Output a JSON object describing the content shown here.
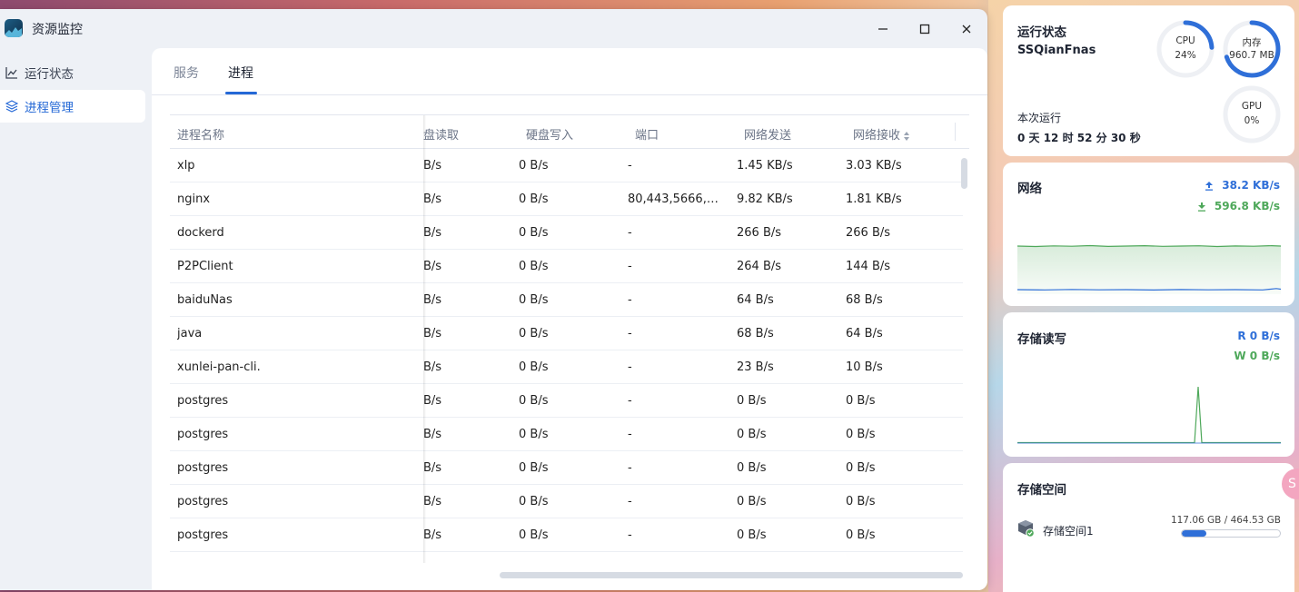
{
  "window": {
    "title": "资源监控",
    "controls": {
      "minimize": "—",
      "maximize": "☐",
      "close": "✕"
    }
  },
  "sidebar": {
    "items": [
      {
        "label": "运行状态",
        "icon": "line-chart-icon",
        "active": false
      },
      {
        "label": "进程管理",
        "icon": "layers-icon",
        "active": true
      }
    ]
  },
  "tabs": [
    {
      "label": "服务",
      "active": false
    },
    {
      "label": "进程",
      "active": true
    }
  ],
  "table": {
    "columns": [
      "进程名称",
      "硬盘读取",
      "硬盘写入",
      "端口",
      "网络发送",
      "网络接收"
    ],
    "read_visible": "盘读取",
    "rows": [
      {
        "name": "xlp",
        "read": "B/s",
        "write": "0 B/s",
        "port": "-",
        "send": "1.45 KB/s",
        "recv": "3.03 KB/s"
      },
      {
        "name": "nginx",
        "read": "B/s",
        "write": "0 B/s",
        "port": "80,443,5666,56...",
        "send": "9.82 KB/s",
        "recv": "1.81 KB/s"
      },
      {
        "name": "dockerd",
        "read": "B/s",
        "write": "0 B/s",
        "port": "-",
        "send": "266 B/s",
        "recv": "266 B/s"
      },
      {
        "name": "P2PClient",
        "read": "B/s",
        "write": "0 B/s",
        "port": "-",
        "send": "264 B/s",
        "recv": "144 B/s"
      },
      {
        "name": "baiduNas",
        "read": "B/s",
        "write": "0 B/s",
        "port": "-",
        "send": "64 B/s",
        "recv": "68 B/s"
      },
      {
        "name": "java",
        "read": "B/s",
        "write": "0 B/s",
        "port": "-",
        "send": "68 B/s",
        "recv": "64 B/s"
      },
      {
        "name": "xunlei-pan-cli.",
        "read": "B/s",
        "write": "0 B/s",
        "port": "-",
        "send": "23 B/s",
        "recv": "10 B/s"
      },
      {
        "name": "postgres",
        "read": "B/s",
        "write": "0 B/s",
        "port": "-",
        "send": "0 B/s",
        "recv": "0 B/s"
      },
      {
        "name": "postgres",
        "read": "B/s",
        "write": "0 B/s",
        "port": "-",
        "send": "0 B/s",
        "recv": "0 B/s"
      },
      {
        "name": "postgres",
        "read": "B/s",
        "write": "0 B/s",
        "port": "-",
        "send": "0 B/s",
        "recv": "0 B/s"
      },
      {
        "name": "postgres",
        "read": "B/s",
        "write": "0 B/s",
        "port": "-",
        "send": "0 B/s",
        "recv": "0 B/s"
      },
      {
        "name": "postgres",
        "read": "B/s",
        "write": "0 B/s",
        "port": "-",
        "send": "0 B/s",
        "recv": "0 B/s"
      }
    ]
  },
  "status_card": {
    "title": "运行状态",
    "host": "SSQianFnas",
    "uptime_label": "本次运行",
    "uptime": "0 天 12 时 52 分 30 秒",
    "gauges": [
      {
        "label": "CPU",
        "value": "24%",
        "fraction": 0.24
      },
      {
        "label": "内存",
        "value": "960.7 MB",
        "fraction": 0.7
      },
      {
        "label": "GPU",
        "value": "0%",
        "fraction": 0
      }
    ],
    "colors": {
      "gauge": "#2f6fd8",
      "track": "#eef0f4"
    }
  },
  "network_card": {
    "title": "网络",
    "upload": "38.2 KB/s",
    "download": "596.8 KB/s",
    "colors": {
      "upload": "#2f6fd8",
      "download": "#4ea85a"
    }
  },
  "storage_io_card": {
    "title": "存储读写",
    "read": "R  0 B/s",
    "write": "W  0 B/s"
  },
  "storage_card": {
    "title": "存储空间",
    "volume_name": "存储空间1",
    "usage": "117.06 GB / 464.53 GB",
    "fraction": 0.252
  },
  "float_button": {
    "label": "S"
  }
}
